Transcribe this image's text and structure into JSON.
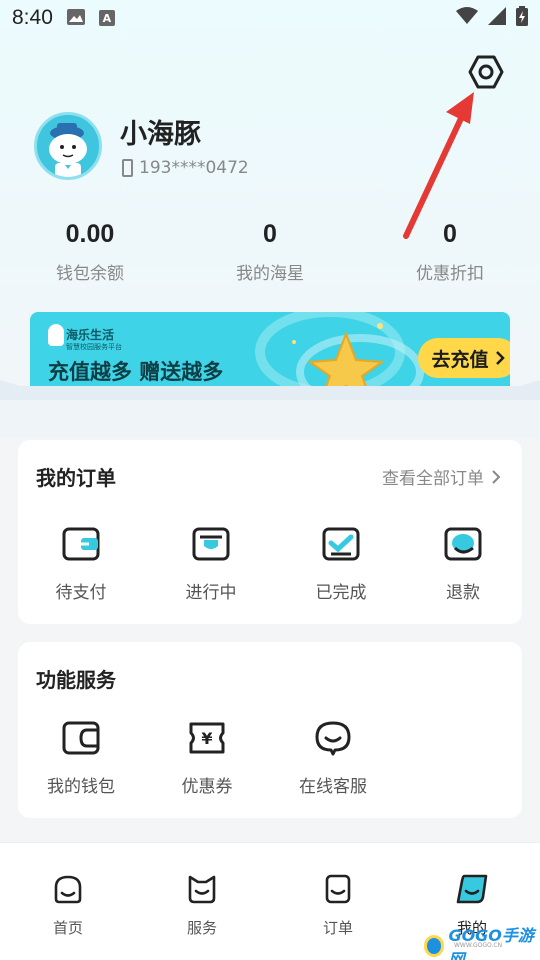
{
  "status_bar": {
    "time": "8:40",
    "icon_a": "A"
  },
  "profile": {
    "name": "小海豚",
    "phone": "193****0472"
  },
  "stats": [
    {
      "value": "0.00",
      "label": "钱包余额"
    },
    {
      "value": "0",
      "label": "我的海星"
    },
    {
      "value": "0",
      "label": "优惠折扣"
    }
  ],
  "banner": {
    "brand": "海乐生活",
    "brand_sub": "智慧校园服务平台",
    "title": "充值越多 赠送越多",
    "button": "去充值"
  },
  "orders": {
    "title": "我的订单",
    "view_all": "查看全部订单",
    "items": [
      {
        "label": "待支付",
        "icon": "wallet-pay-icon"
      },
      {
        "label": "进行中",
        "icon": "in-progress-icon"
      },
      {
        "label": "已完成",
        "icon": "completed-check-icon"
      },
      {
        "label": "退款",
        "icon": "refund-icon"
      }
    ]
  },
  "services": {
    "title": "功能服务",
    "items": [
      {
        "label": "我的钱包",
        "icon": "wallet-icon"
      },
      {
        "label": "优惠券",
        "icon": "coupon-icon"
      },
      {
        "label": "在线客服",
        "icon": "customer-service-icon"
      }
    ]
  },
  "nav": [
    {
      "label": "首页",
      "icon": "home-icon"
    },
    {
      "label": "服务",
      "icon": "service-icon"
    },
    {
      "label": "订单",
      "icon": "order-icon"
    },
    {
      "label": "我的",
      "icon": "profile-icon",
      "active": true
    }
  ],
  "watermark": {
    "text": "GOGO手游网",
    "sub": "WWW.GOGO.CN"
  },
  "colors": {
    "accent": "#3ed3e6",
    "button_yellow": "#ffd84a",
    "arrow_red": "#e53935"
  }
}
